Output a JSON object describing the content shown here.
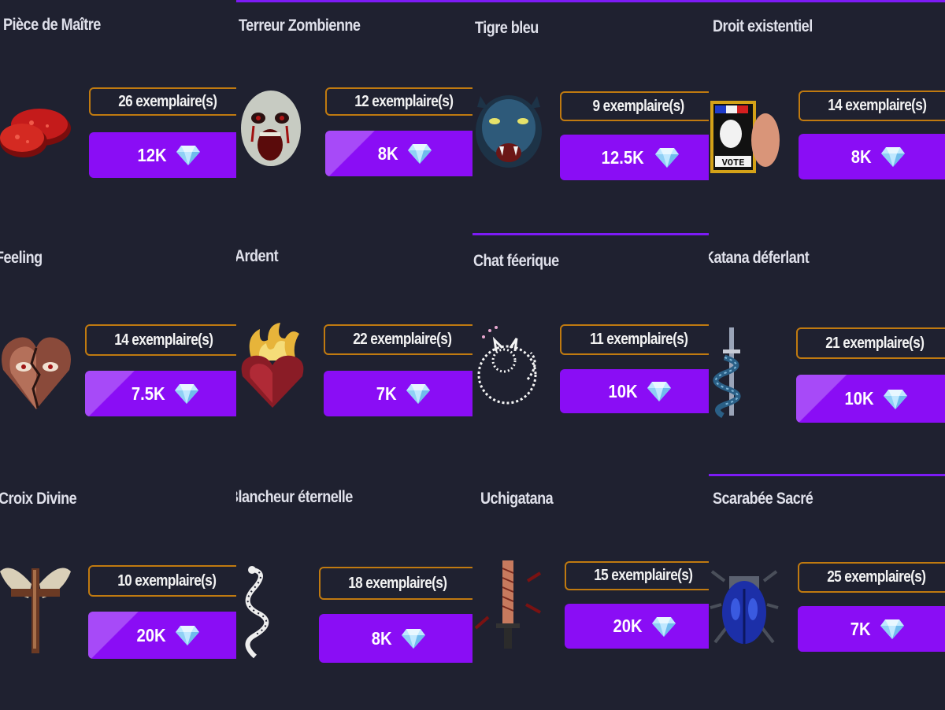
{
  "cards": [
    {
      "name": "Pièce de Maître",
      "count": "26 exemplaire(s)",
      "price": "12K",
      "icon": "steak-icon",
      "shine": false,
      "topline": false
    },
    {
      "name": "Terreur Zombienne",
      "count": "12 exemplaire(s)",
      "price": "8K",
      "icon": "zombie-face-icon",
      "shine": true,
      "topline": true
    },
    {
      "name": "Tigre bleu",
      "count": "9 exemplaire(s)",
      "price": "12.5K",
      "icon": "blue-panther-icon",
      "shine": false,
      "topline": true
    },
    {
      "name": "Droit existentiel",
      "count": "14 exemplaire(s)",
      "price": "8K",
      "icon": "vote-ballot-icon",
      "shine": false,
      "topline": true
    },
    {
      "name": "Feeling",
      "count": "14 exemplaire(s)",
      "price": "7.5K",
      "icon": "broken-heart-icon",
      "shine": true,
      "topline": false
    },
    {
      "name": "Ardent",
      "count": "22 exemplaire(s)",
      "price": "7K",
      "icon": "flaming-heart-icon",
      "shine": false,
      "topline": false
    },
    {
      "name": "Chat féerique",
      "count": "11 exemplaire(s)",
      "price": "10K",
      "icon": "fairy-cat-icon",
      "shine": false,
      "topline": true
    },
    {
      "name": "Katana déferlant",
      "count": "21 exemplaire(s)",
      "price": "10K",
      "icon": "serpent-katana-icon",
      "shine": true,
      "topline": false
    },
    {
      "name": "Croix Divine",
      "count": "10 exemplaire(s)",
      "price": "20K",
      "icon": "winged-cross-icon",
      "shine": true,
      "topline": false
    },
    {
      "name": "Blancheur éternelle",
      "count": "18 exemplaire(s)",
      "price": "8K",
      "icon": "white-serpent-icon",
      "shine": false,
      "topline": false
    },
    {
      "name": "Uchigatana",
      "count": "15 exemplaire(s)",
      "price": "20K",
      "icon": "uchigatana-sword-icon",
      "shine": false,
      "topline": false
    },
    {
      "name": "Scarabée Sacré",
      "count": "25 exemplaire(s)",
      "price": "7K",
      "icon": "blue-scarab-icon",
      "shine": false,
      "topline": true
    }
  ],
  "colors": {
    "background": "#1f2130",
    "accent": "#8a0df5",
    "count_border": "#c07a10",
    "title_text": "#dfe0ea"
  },
  "currency_icon": "diamond-icon"
}
